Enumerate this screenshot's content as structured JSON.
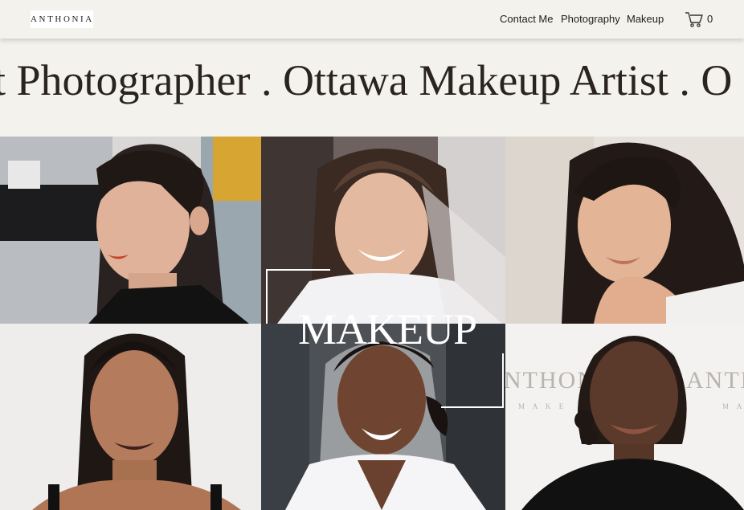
{
  "header": {
    "logo_text": "ANTHONIA",
    "nav": [
      "Contact Me",
      "Photography",
      "Makeup"
    ],
    "cart_icon": "shopping-cart-icon",
    "cart_count": "0"
  },
  "marquee": {
    "text": "t Photographer .  Ottawa Makeup Artist .  O"
  },
  "gallery": {
    "overlay_title": "MAKEUP",
    "photos": [
      "Portrait of woman in profile with dark lipstick",
      "Smiling bride in white robe",
      "Woman with long dark hair leaning on wall",
      "Woman with brown lipstick, eyes closed",
      "Smiling bride with veil",
      "Smiling woman with braided hair at event"
    ],
    "backdrop_text": "NTHONI",
    "backdrop_subtext": "M A K E",
    "backdrop_text_2": "ANTH",
    "backdrop_subtext_2": "M A"
  },
  "colors": {
    "background": "#f4f2ed",
    "text_dark": "#2a2420",
    "white": "#ffffff"
  }
}
